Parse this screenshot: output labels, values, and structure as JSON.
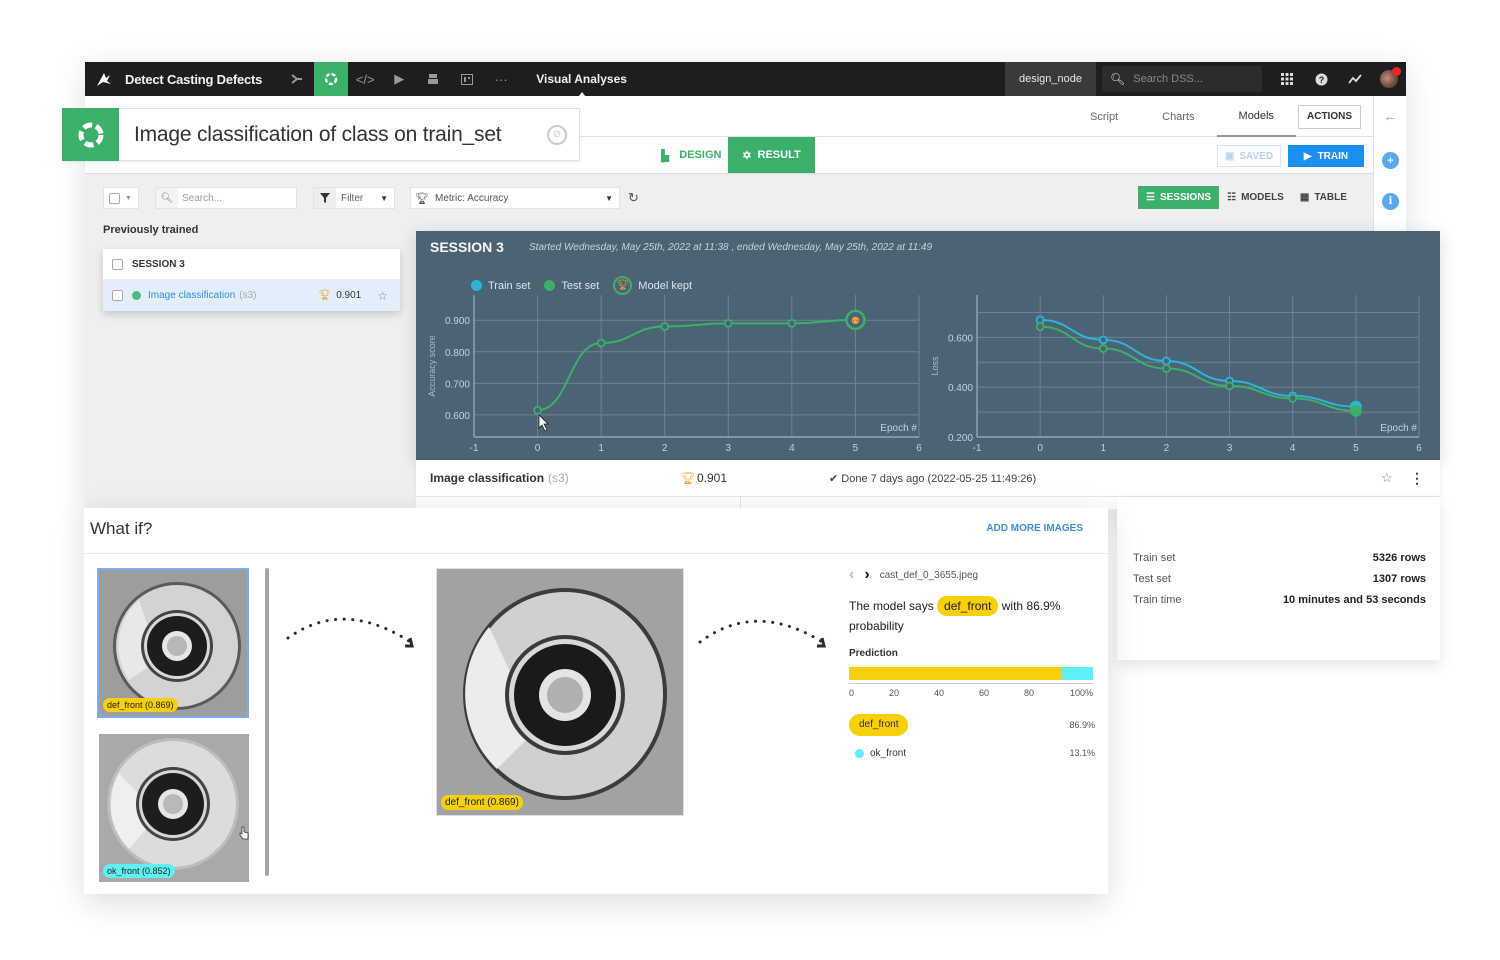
{
  "topbar": {
    "project": "Detect Casting Defects",
    "section": "Visual Analyses",
    "node": "design_node",
    "search_placeholder": "Search DSS..."
  },
  "title": {
    "text": "Image classification of class on train_set"
  },
  "nav_tabs": [
    {
      "label": "Script",
      "active": false
    },
    {
      "label": "Charts",
      "active": false
    },
    {
      "label": "Models",
      "active": true
    }
  ],
  "actions_label": "ACTIONS",
  "mode_tabs": {
    "design": "DESIGN",
    "result": "RESULT"
  },
  "buttons": {
    "saved": "SAVED",
    "train": "TRAIN"
  },
  "toolbar": {
    "search_placeholder": "Search...",
    "filter": "Filter",
    "metric": "Metric: Accuracy"
  },
  "view_buttons": [
    {
      "label": "SESSIONS",
      "active": true
    },
    {
      "label": "MODELS",
      "active": false
    },
    {
      "label": "TABLE",
      "active": false
    }
  ],
  "sessions_list": {
    "heading": "Previously trained",
    "session_label": "SESSION 3",
    "model": {
      "name": "Image classification",
      "sub": "(s3)",
      "score": "0.901",
      "status_color": "#4dbb7f"
    }
  },
  "session_panel": {
    "title": "SESSION 3",
    "dates": "Started Wednesday, May 25th, 2022 at 11:38 , ended Wednesday, May 25th, 2022 at 11:49",
    "legend": [
      {
        "label": "Train set",
        "color": "#2bb5d9"
      },
      {
        "label": "Test set",
        "color": "#3bb06a"
      },
      {
        "label": "Model kept",
        "color": "#f0a22a"
      }
    ]
  },
  "chart_data": [
    {
      "type": "line",
      "title": "",
      "xlabel": "Epoch #",
      "ylabel": "Accuracy score",
      "xlim": [
        -1,
        6
      ],
      "ylim": [
        0.53,
        0.98
      ],
      "x_ticks": [
        "-1",
        "0",
        "1",
        "2",
        "3",
        "4",
        "5",
        "6"
      ],
      "y_ticks": [
        "0.600",
        "0.700",
        "0.800",
        "0.900"
      ],
      "grid": true,
      "series": [
        {
          "name": "Test set",
          "color": "#3bb06a",
          "x": [
            0,
            1,
            2,
            3,
            4,
            5
          ],
          "y": [
            0.615,
            0.828,
            0.88,
            0.89,
            0.89,
            0.901
          ]
        }
      ],
      "annotations": [
        {
          "type": "model-kept",
          "x": 5,
          "y": 0.901
        }
      ]
    },
    {
      "type": "line",
      "title": "",
      "xlabel": "Epoch #",
      "ylabel": "Loss",
      "xlim": [
        -1,
        6
      ],
      "ylim": [
        0.2,
        0.77
      ],
      "x_ticks": [
        "-1",
        "0",
        "1",
        "2",
        "3",
        "4",
        "5",
        "6"
      ],
      "y_ticks": [
        "0.200",
        "0.400",
        "0.600"
      ],
      "grid": true,
      "series": [
        {
          "name": "Train set",
          "color": "#2bb5d9",
          "x": [
            0,
            1,
            2,
            3,
            4,
            5
          ],
          "y": [
            0.67,
            0.59,
            0.505,
            0.425,
            0.365,
            0.322
          ]
        },
        {
          "name": "Test set",
          "color": "#3bb06a",
          "x": [
            0,
            1,
            2,
            3,
            4,
            5
          ],
          "y": [
            0.643,
            0.555,
            0.475,
            0.405,
            0.355,
            0.305
          ]
        }
      ]
    }
  ],
  "summary": {
    "name": "Image classification",
    "sub": "(s3)",
    "score": "0.901",
    "status": "Done 7 days ago (2022-05-25 11:49:26)"
  },
  "details": [
    {
      "label": "Train set",
      "value": "5326 rows"
    },
    {
      "label": "Test set",
      "value": "1307 rows"
    },
    {
      "label": "Train time",
      "value": "10 minutes and 53 seconds"
    }
  ],
  "whatif": {
    "title": "What if?",
    "add_more": "ADD MORE IMAGES",
    "thumbnails": [
      {
        "label": "def_front (0.869)",
        "class": "def",
        "selected": true
      },
      {
        "label": "ok_front (0.852)",
        "class": "ok",
        "selected": false
      }
    ],
    "main_image_label": "def_front (0.869)",
    "filename": "cast_def_0_3655.jpeg",
    "says_prefix": "The model says",
    "says_class": "def_front",
    "says_suffix": "with 86.9% probability",
    "prediction_label": "Prediction",
    "bar": [
      {
        "class": "def_front",
        "fraction": 0.869,
        "color": "#f7cf0a"
      },
      {
        "class": "ok_front",
        "fraction": 0.131,
        "color": "#5ef0f5"
      }
    ],
    "axis_ticks": [
      "0",
      "20",
      "40",
      "60",
      "80",
      "100%"
    ],
    "classes": [
      {
        "name": "def_front",
        "pct": "86.9%"
      },
      {
        "name": "ok_front",
        "pct": "13.1%"
      }
    ]
  }
}
